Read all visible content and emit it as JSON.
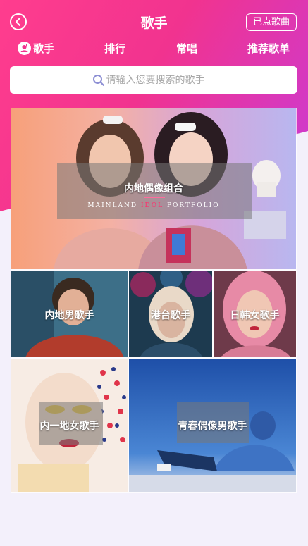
{
  "header": {
    "title": "歌手",
    "right_button": "已点歌曲"
  },
  "tabs": [
    {
      "label": "歌手",
      "icon": "singer-icon"
    },
    {
      "label": "排行"
    },
    {
      "label": "常唱"
    },
    {
      "label": "推荐歌单"
    }
  ],
  "search": {
    "placeholder": "请输入您要搜索的歌手"
  },
  "categories": {
    "mainland_group": {
      "label": "内地偶像组合",
      "subtitle_pre": "MAINLAND ",
      "subtitle_hl": "IDOL",
      "subtitle_post": " PORTFOLIO"
    },
    "mainland_male": {
      "label": "内地男歌手"
    },
    "hk_tw": {
      "label": "港台歌手"
    },
    "jp_kr_female": {
      "label": "日韩女歌手"
    },
    "mainland_female": {
      "label": "内一地女歌手"
    },
    "youth_male": {
      "label": "青春偶像男歌手"
    }
  },
  "colors": {
    "header_start": "#ff3d8e",
    "header_end": "#c93bd6",
    "accent": "#ff2f6d",
    "page_bg": "#f3f0fb"
  }
}
